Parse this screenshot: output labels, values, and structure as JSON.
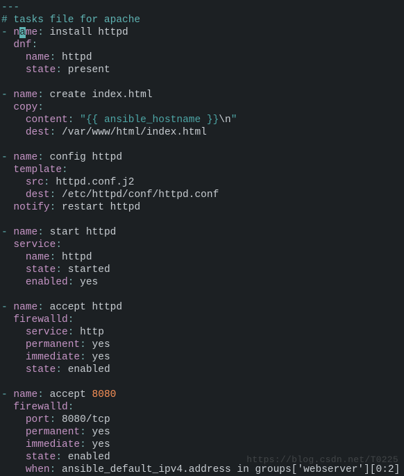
{
  "doc_start": "---",
  "comment": "# tasks file for apache",
  "tasks": [
    {
      "name": "install httpd",
      "module": "dnf",
      "params": {
        "name": "httpd",
        "state": "present"
      }
    },
    {
      "name": "create index.html",
      "module": "copy",
      "params": {
        "content_open": "\"",
        "content_expr": "{{ ansible_hostname }}",
        "content_esc": "\\n",
        "content_close": "\"",
        "dest": "/var/www/html/index.html"
      }
    },
    {
      "name": "config httpd",
      "module": "template",
      "params": {
        "src": "httpd.conf.j2",
        "dest": "/etc/httpd/conf/httpd.conf"
      },
      "notify": "restart httpd"
    },
    {
      "name": "start httpd",
      "module": "service",
      "params": {
        "name": "httpd",
        "state": "started",
        "enabled": "yes"
      }
    },
    {
      "name": "accept httpd",
      "module": "firewalld",
      "params": {
        "service": "http",
        "permanent": "yes",
        "immediate": "yes",
        "state": "enabled"
      }
    },
    {
      "name": "accept ",
      "name_num": "8080",
      "module": "firewalld",
      "params": {
        "port": "8080/tcp",
        "permanent": "yes",
        "immediate": "yes",
        "state": "enabled"
      },
      "when": "ansible_default_ipv4.address in groups['webserver'][0:2]"
    }
  ],
  "watermark": "https://blog.csdn.net/T0225"
}
